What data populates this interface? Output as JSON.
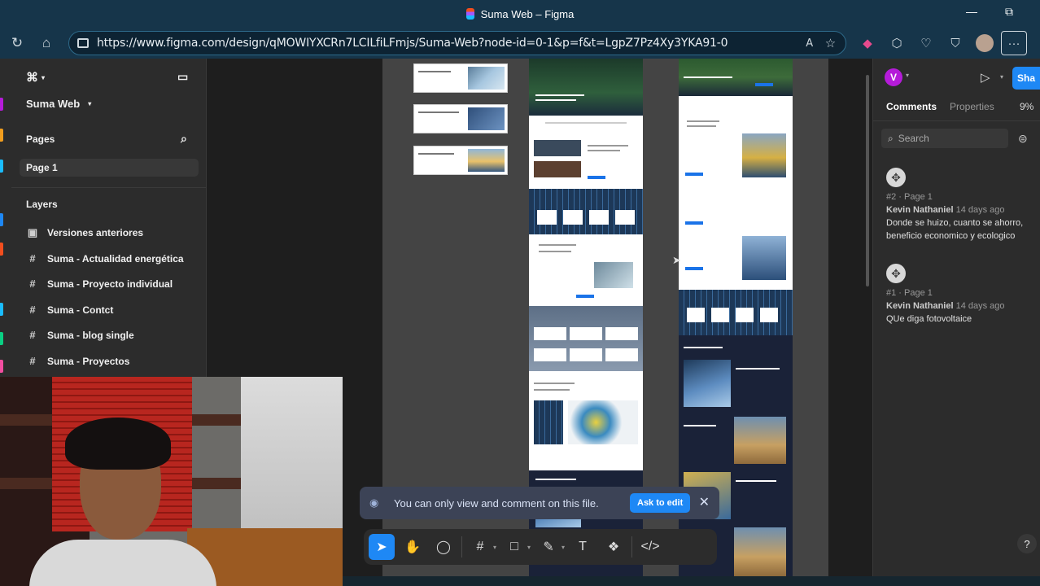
{
  "browser": {
    "window_title": "Suma Web – Figma",
    "url": "https://www.figma.com/design/qMOWIYXCRn7LCILfiLFmjs/Suma-Web?node-id=0-1&p=f&t=LgpZ7Pz4Xy3YKA91-0",
    "win_minimize": "—",
    "win_restore": "⧉"
  },
  "left_panel": {
    "file_name": "Suma Web",
    "pages_heading": "Pages",
    "current_page": "Page 1",
    "layers_heading": "Layers",
    "layers": [
      {
        "icon": "▣",
        "label": "Versiones anteriores"
      },
      {
        "icon": "#",
        "label": "Suma - Actualidad energética"
      },
      {
        "icon": "#",
        "label": "Suma - Proyecto individual"
      },
      {
        "icon": "#",
        "label": "Suma - Contct"
      },
      {
        "icon": "#",
        "label": "Suma - blog single"
      },
      {
        "icon": "#",
        "label": "Suma - Proyectos"
      }
    ]
  },
  "notice": {
    "message": "You can only view and comment on this file.",
    "action": "Ask to edit"
  },
  "right_panel": {
    "avatar_letter": "V",
    "share_label": "Sha",
    "tabs": {
      "comments": "Comments",
      "properties": "Properties"
    },
    "zoom": "9%",
    "search_placeholder": "Search",
    "comments": [
      {
        "id": "#2 · Page 1",
        "author": "Kevin Nathaniel",
        "time": "14 days ago",
        "text": "Donde se huizo, cuanto se ahorro, beneficio economico y ecologico"
      },
      {
        "id": "#1 · Page 1",
        "author": "Kevin Nathaniel",
        "time": "14 days ago",
        "text": "QUe diga fotovoltaice"
      }
    ],
    "help": "?"
  },
  "colors": {
    "accent": "#1e88f5",
    "browser_chrome": "#16354a",
    "panel_bg": "#2c2c2c",
    "canvas_bg": "#1e1e1e"
  }
}
